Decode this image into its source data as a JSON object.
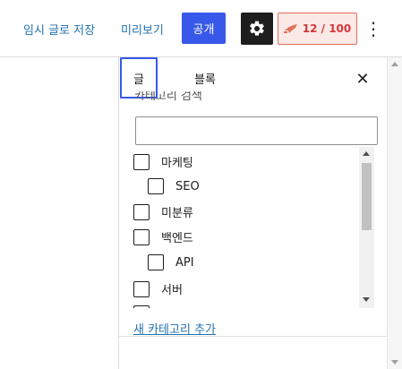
{
  "toolbar": {
    "save_draft": "임시 글로 저장",
    "preview": "미리보기",
    "publish": "공개",
    "settings_icon": "gear-icon",
    "score": "12 / 100",
    "score_icon": "rocket-icon",
    "more_icon": "vertical-ellipsis-icon",
    "colors": {
      "primary": "#3858e9",
      "score_text": "#d63638",
      "score_bg": "#fbe9e7",
      "score_border": "#e26f56",
      "link": "#2271b1"
    }
  },
  "sidebar": {
    "tabs": [
      {
        "label": "글",
        "active": true
      },
      {
        "label": "블록",
        "active": false
      }
    ],
    "close_icon": "close-icon",
    "categories": {
      "title": "카테고리 검색",
      "search_value": "",
      "items": [
        {
          "label": "마케팅",
          "checked": false,
          "indent": 0
        },
        {
          "label": "SEO",
          "checked": false,
          "indent": 1
        },
        {
          "label": "미분류",
          "checked": false,
          "indent": 0
        },
        {
          "label": "백엔드",
          "checked": false,
          "indent": 0
        },
        {
          "label": "API",
          "checked": false,
          "indent": 1
        },
        {
          "label": "서버",
          "checked": false,
          "indent": 0
        }
      ],
      "add_new": "새 카테고리 추가"
    }
  }
}
